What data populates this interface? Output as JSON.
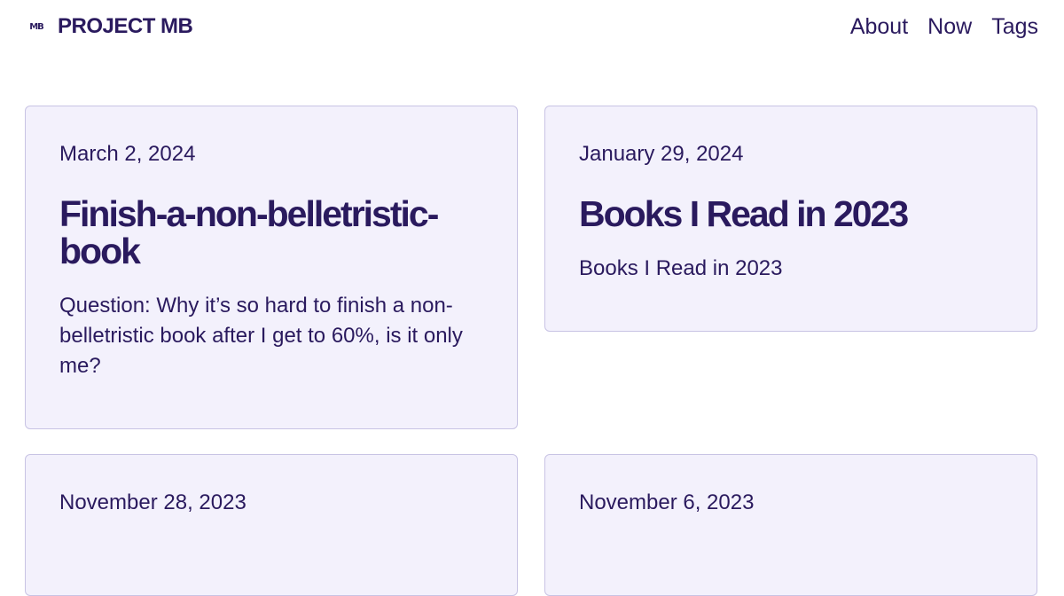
{
  "site": {
    "logo_mark": "MB",
    "title": "PROJECT MB"
  },
  "nav": {
    "items": [
      "About",
      "Now",
      "Tags"
    ]
  },
  "posts": [
    {
      "date": "March 2, 2024",
      "title": "Finish-a-non-belletristic-book",
      "excerpt": "Question: Why it’s so hard to finish a non-belletristic book after I get to 60%, is it only me?"
    },
    {
      "date": "January 29, 2024",
      "title": "Books I Read in 2023",
      "excerpt": "Books I Read in 2023"
    },
    {
      "date": "November 28, 2023"
    },
    {
      "date": "November 6, 2023"
    }
  ],
  "colors": {
    "text": "#2a1a5e",
    "card_bg": "#f3f1fc",
    "card_border": "#c8c3e4"
  }
}
